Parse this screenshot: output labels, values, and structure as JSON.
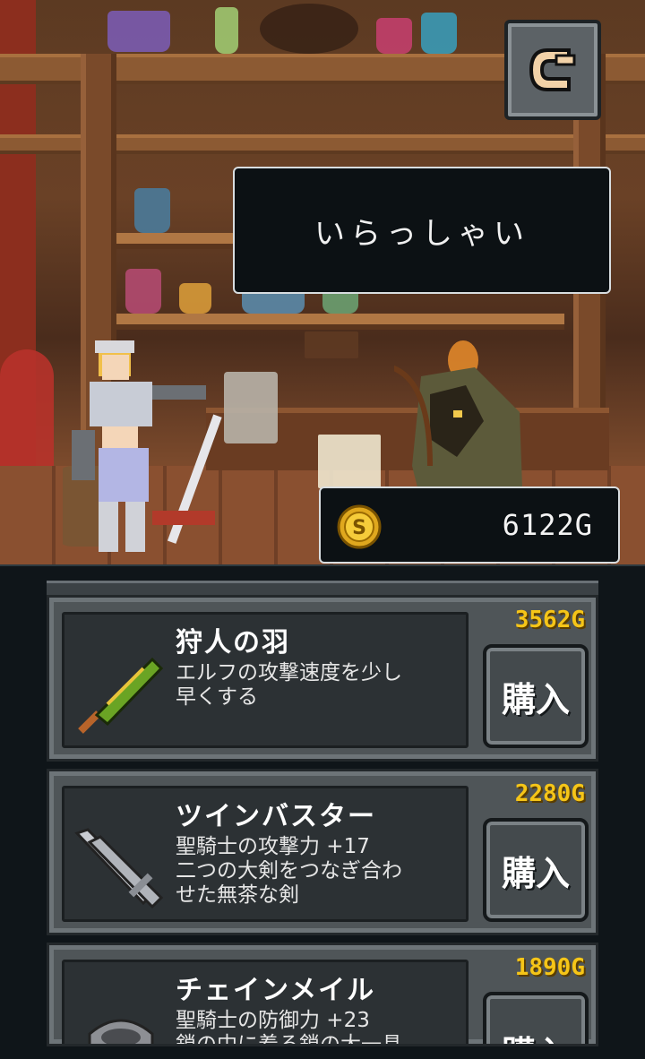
{
  "dialog": {
    "text": "いらっしゃい"
  },
  "gold": {
    "amount": "6122G",
    "icon": "gold-coin-icon"
  },
  "exit": {
    "icon": "exit-arrow-icon"
  },
  "colors": {
    "price": "#f5c518",
    "panel": "#4f5558",
    "dialog_bg": "#0c1114"
  },
  "items": [
    {
      "name": "狩人の羽",
      "desc": [
        "エルフの攻撃速度を少し",
        "早くする"
      ],
      "price": "3562G",
      "buy": "購入",
      "icon": "feather-icon"
    },
    {
      "name": "ツインバスター",
      "desc": [
        "聖騎士の攻撃力 +17",
        "二つの大剣をつなぎ合わ",
        "せた無茶な剣"
      ],
      "price": "2280G",
      "buy": "購入",
      "icon": "twin-sword-icon"
    },
    {
      "name": "チェインメイル",
      "desc": [
        "聖騎士の防御力 +23",
        "鎖の中に着る鎖の大一具"
      ],
      "price": "1890G",
      "buy": "購入",
      "icon": "chainmail-icon"
    }
  ]
}
